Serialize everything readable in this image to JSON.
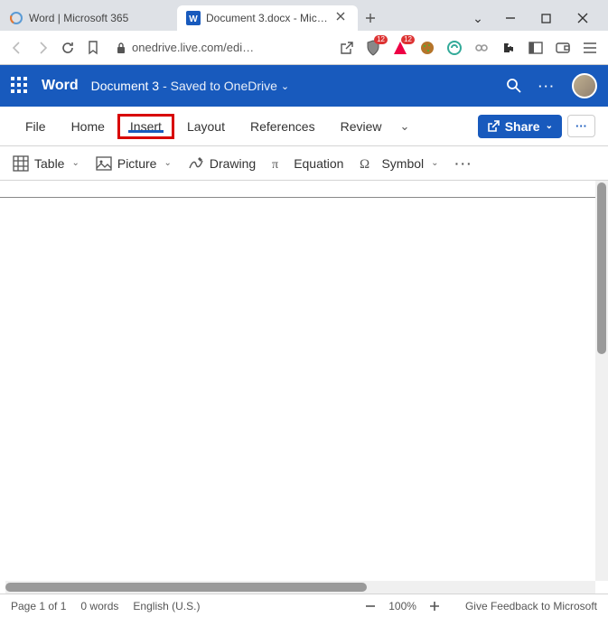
{
  "browser": {
    "tabs": [
      {
        "title": "Word | Microsoft 365"
      },
      {
        "title": "Document 3.docx - Micros"
      }
    ],
    "url": "onedrive.live.com/edi…",
    "extensions": {
      "brave_badge": "12",
      "a_badge": "12"
    }
  },
  "word": {
    "app": "Word",
    "doc": "Document 3",
    "save_status": "- Saved to OneDrive"
  },
  "ribbon_tabs": {
    "file": "File",
    "home": "Home",
    "insert": "Insert",
    "layout": "Layout",
    "references": "References",
    "review": "Review"
  },
  "share": "Share",
  "toolbar": {
    "table": "Table",
    "picture": "Picture",
    "drawing": "Drawing",
    "equation": "Equation",
    "symbol": "Symbol"
  },
  "status": {
    "page": "Page 1 of 1",
    "words": "0 words",
    "lang": "English (U.S.)",
    "zoom": "100%",
    "feedback": "Give Feedback to Microsoft"
  }
}
